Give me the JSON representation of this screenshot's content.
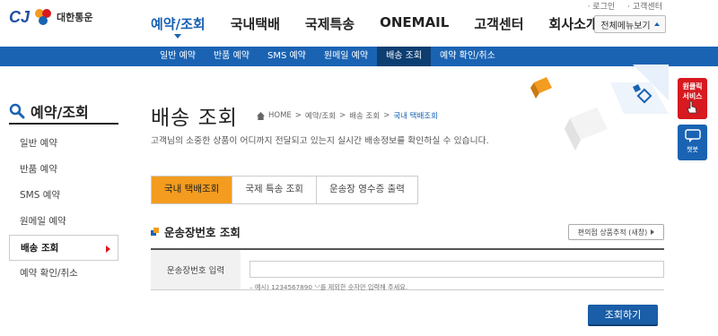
{
  "header": {
    "util_links": [
      "로그인",
      "고객센터"
    ],
    "logo_text": "CJ",
    "company_name": "대한통운",
    "gnb": [
      {
        "label": "예약/조회",
        "active": true
      },
      {
        "label": "국내택배",
        "active": false
      },
      {
        "label": "국제특송",
        "active": false
      },
      {
        "label": "ONEMAIL",
        "active": false
      },
      {
        "label": "고객센터",
        "active": false
      },
      {
        "label": "회사소개",
        "active": false
      }
    ],
    "all_menu_label": "전체메뉴보기",
    "sub_menu": [
      {
        "label": "일반 예약",
        "active": false
      },
      {
        "label": "반품 예약",
        "active": false
      },
      {
        "label": "SMS 예약",
        "active": false
      },
      {
        "label": "원메일 예약",
        "active": false
      },
      {
        "label": "배송 조회",
        "active": true
      },
      {
        "label": "예약 확인/취소",
        "active": false
      }
    ]
  },
  "sidebar": {
    "title": "예약/조회",
    "items": [
      {
        "label": "일반 예약",
        "active": false
      },
      {
        "label": "반품 예약",
        "active": false
      },
      {
        "label": "SMS 예약",
        "active": false
      },
      {
        "label": "원메일 예약",
        "active": false
      },
      {
        "label": "배송 조회",
        "active": true
      },
      {
        "label": "예약 확인/취소",
        "active": false
      }
    ]
  },
  "main": {
    "title": "배송 조회",
    "breadcrumb": [
      "HOME",
      "예약/조회",
      "배송 조회",
      "국내 택배조회"
    ],
    "description": "고객님의 소중한 상품이 어디까지 전달되고 있는지 실시간 배송정보를 확인하실 수 있습니다.",
    "tabs": [
      {
        "label": "국내 택배조회",
        "active": true
      },
      {
        "label": "국제 특송 조회",
        "active": false
      },
      {
        "label": "운송장 영수증 출력",
        "active": false
      }
    ],
    "section_title": "운송장번호 조회",
    "trace_button": "편의점 상품추적 (새창)",
    "form": {
      "label": "운송장번호 입력",
      "value": "",
      "placeholder": "",
      "hint": "– 예시) 1234567890 '-'를 제외한 숫자만 입력해 주세요."
    },
    "submit_label": "조회하기"
  },
  "widgets": {
    "oneclick_label_1": "원클릭",
    "oneclick_label_2": "서비스",
    "chatbot_label": "챗봇"
  },
  "colors": {
    "brand_blue": "#1a63b3",
    "accent_orange": "#f39c1f",
    "cj_red": "#d71920"
  }
}
